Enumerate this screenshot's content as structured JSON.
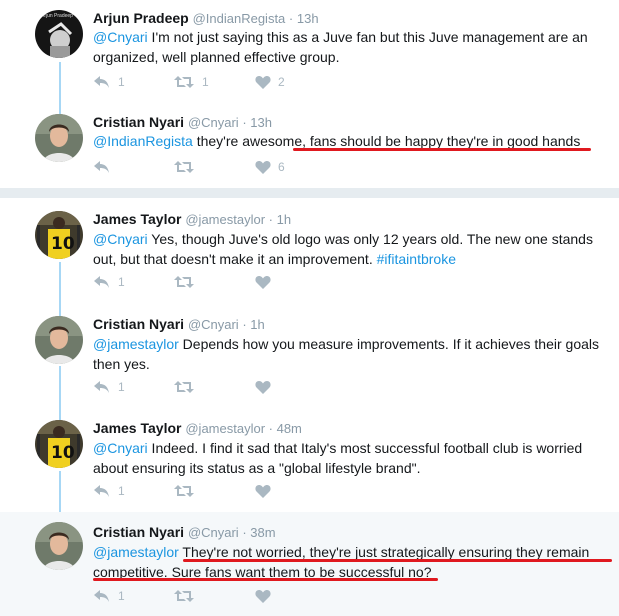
{
  "group1": {
    "tweets": [
      {
        "name": "Arjun Pradeep",
        "handle": "@IndianRegista",
        "time": "13h",
        "mention": "@Cnyari",
        "body": " I'm not just saying this as a Juve fan but this Juve management are an organized, well planned effective group.",
        "replies": "1",
        "retweets": "1",
        "likes": "2"
      },
      {
        "name": "Cristian Nyari",
        "handle": "@Cnyari",
        "time": "13h",
        "mention": "@IndianRegista",
        "body": " they're awesome, fans should be happy they're in good hands",
        "replies": "",
        "retweets": "",
        "likes": "6"
      }
    ]
  },
  "group2": {
    "tweets": [
      {
        "name": "James Taylor",
        "handle": "@jamestaylor",
        "time": "1h",
        "mention": "@Cnyari",
        "body": " Yes, though Juve's old logo was only 12 years old. The new one stands out, but that doesn't make it an improvement. ",
        "hashtag": "#ifitaintbroke",
        "replies": "1",
        "retweets": "",
        "likes": ""
      },
      {
        "name": "Cristian Nyari",
        "handle": "@Cnyari",
        "time": "1h",
        "mention": "@jamestaylor",
        "body": " Depends how you measure improvements. If it achieves their goals then yes.",
        "replies": "1",
        "retweets": "",
        "likes": ""
      },
      {
        "name": "James Taylor",
        "handle": "@jamestaylor",
        "time": "48m",
        "mention": "@Cnyari",
        "body": " Indeed. I find it sad that Italy's most successful football club is worried about ensuring its status as a \"global lifestyle brand\".",
        "replies": "1",
        "retweets": "",
        "likes": ""
      },
      {
        "name": "Cristian Nyari",
        "handle": "@Cnyari",
        "time": "38m",
        "mention": "@jamestaylor",
        "body": " They're not worried, they're just strategically ensuring they remain competitive. Sure fans want them to be successful no?",
        "replies": "1",
        "retweets": "",
        "likes": ""
      }
    ]
  },
  "separator": " · ",
  "avatar_label": "Arjun Pradeep",
  "jersey_number": "10",
  "colors": {
    "link": "#1b95e0",
    "muted": "#8899a6",
    "icon": "#aab8c2",
    "thread": "#a7d7f5",
    "highlight_bg": "#f5f8fa",
    "divider": "#e6ecf0",
    "annotation": "#e0191f"
  },
  "icons": {
    "reply": "reply-icon",
    "retweet": "retweet-icon",
    "like": "heart-icon"
  }
}
